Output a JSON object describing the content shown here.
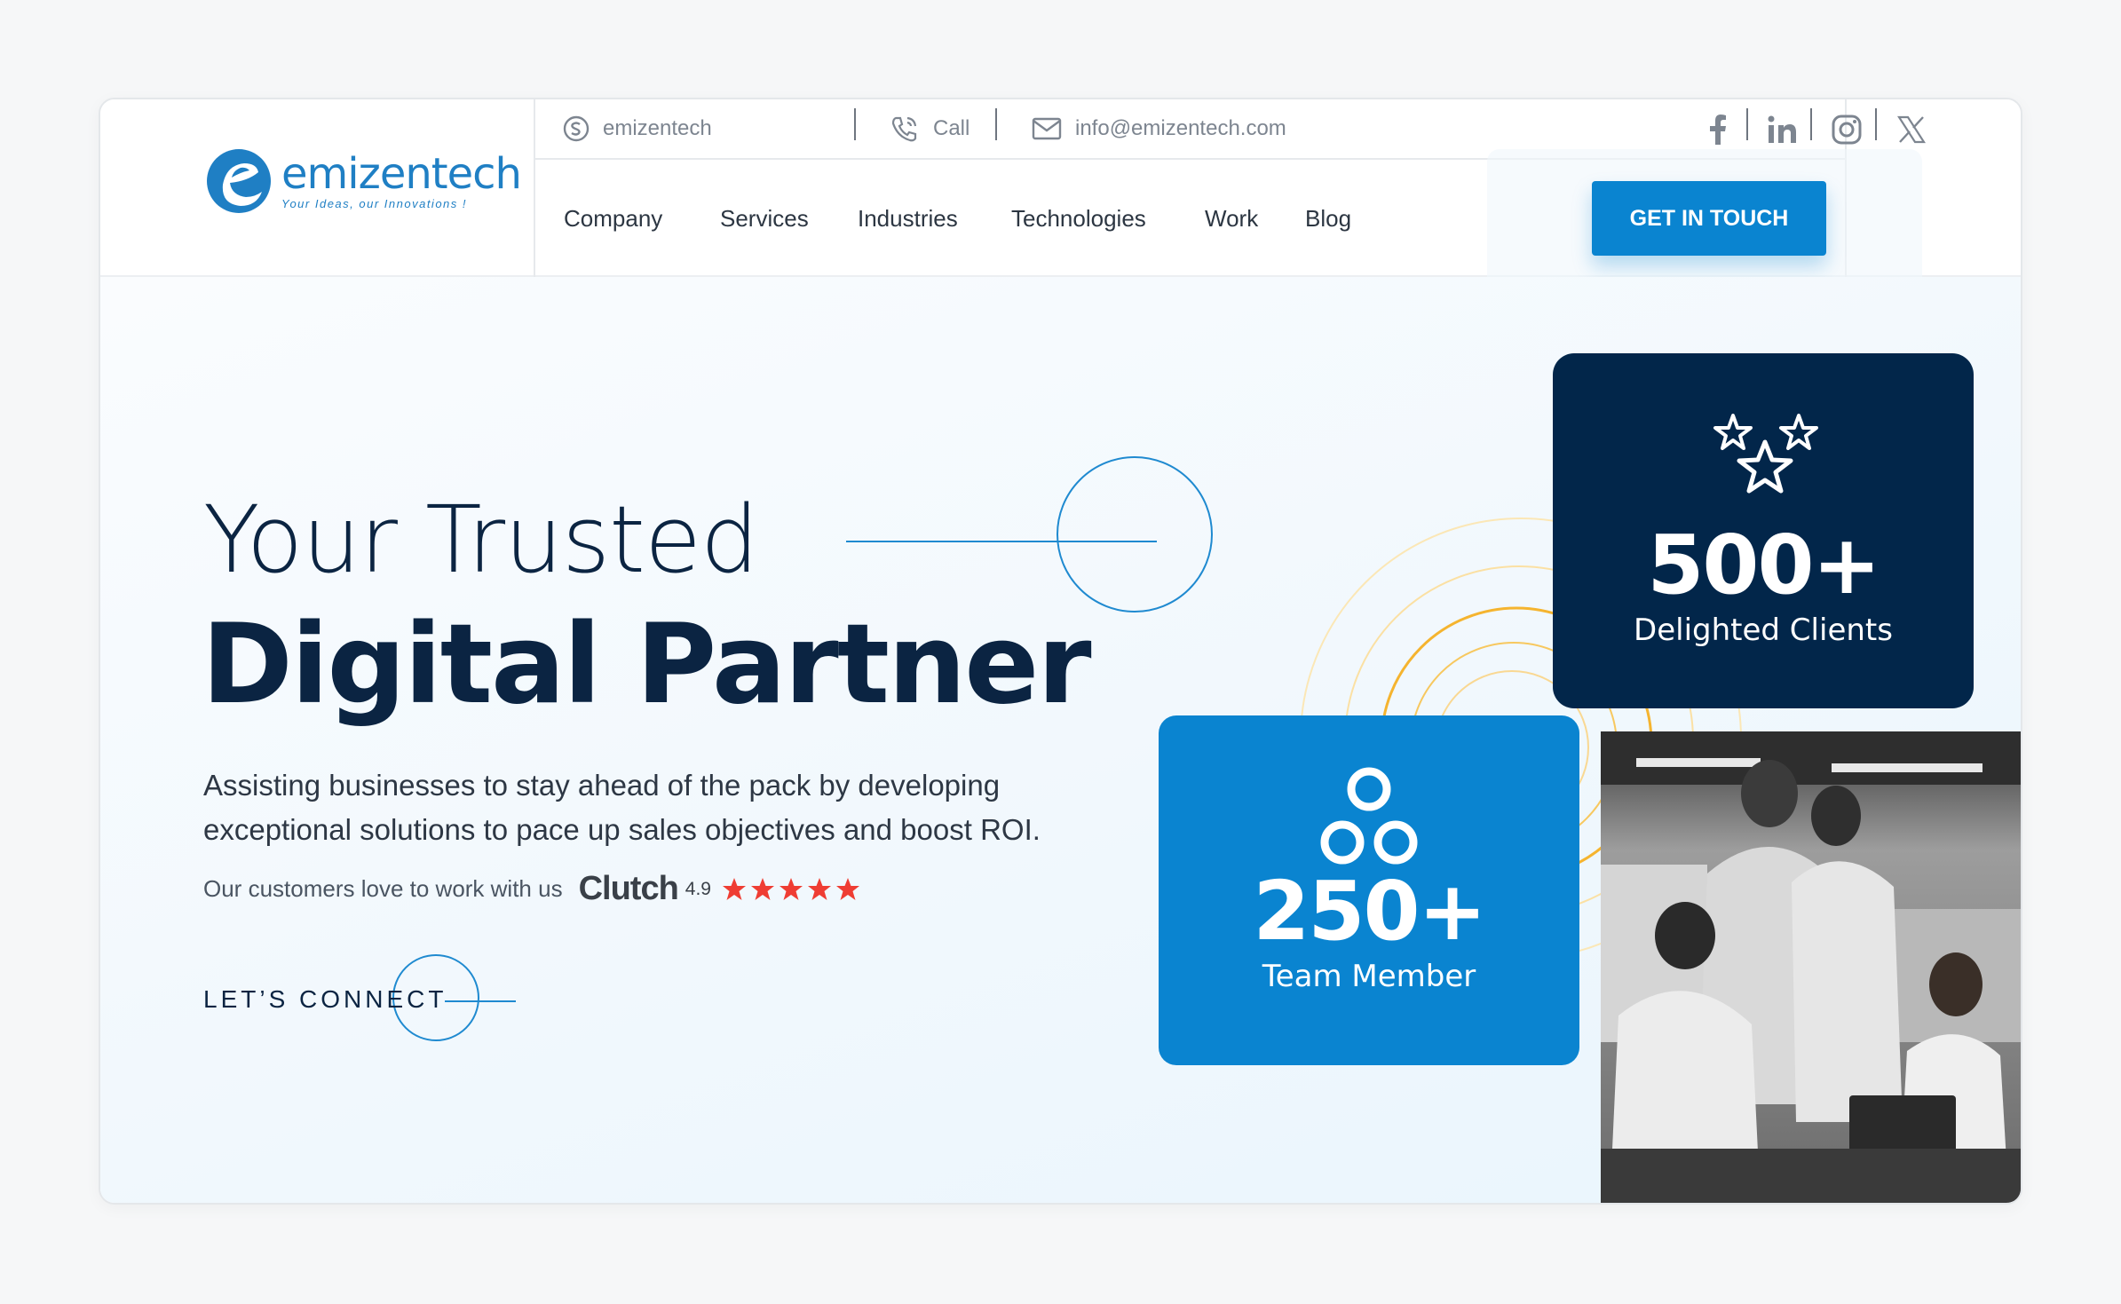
{
  "brand": {
    "name": "emizentech",
    "tagline": "Your Ideas, our Innovations !",
    "primary_color": "#0a84d0",
    "navy_color": "#02264a"
  },
  "topbar": {
    "skype": "emizentech",
    "call": "Call",
    "email": "info@emizentech.com",
    "socials": [
      "facebook-icon",
      "linkedin-icon",
      "instagram-icon",
      "x-icon"
    ]
  },
  "nav": {
    "items": [
      "Company",
      "Services",
      "Industries",
      "Technologies",
      "Work",
      "Blog"
    ],
    "cta": "GET IN TOUCH"
  },
  "hero": {
    "title_line1": "Your Trusted",
    "title_line2": "Digital Partner",
    "description": "Assisting businesses to stay ahead of the pack by developing exceptional solutions to pace up sales objectives and boost ROI.",
    "clutch_pre": "Our customers love to work with us",
    "clutch_brand": "Clutch",
    "clutch_score": "4.9",
    "clutch_stars": 5,
    "connect": "LET’S CONNECT"
  },
  "stats": {
    "clients": {
      "value": "500+",
      "label": "Delighted Clients"
    },
    "team": {
      "value": "250+",
      "label": "Team Member"
    }
  }
}
